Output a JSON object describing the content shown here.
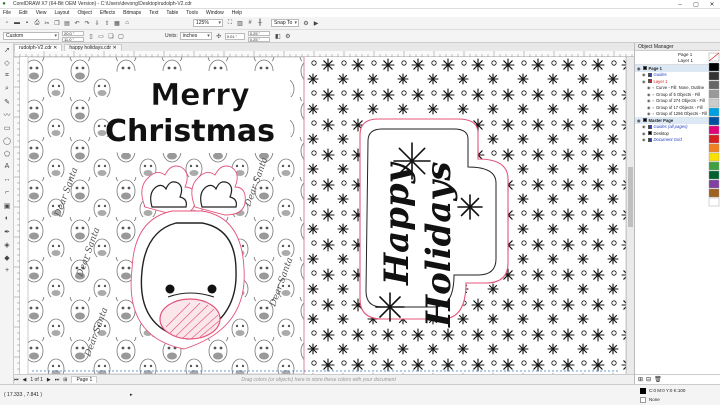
{
  "window": {
    "title": "CorelDRAW X7 (64-Bit OEM Version) - C:\\Users\\devong\\Desktop\\rudolph-V2.cdr",
    "min": "–",
    "max": "▢",
    "close": "✕"
  },
  "menu": [
    "File",
    "Edit",
    "View",
    "Layout",
    "Object",
    "Effects",
    "Bitmaps",
    "Text",
    "Table",
    "Tools",
    "Window",
    "Help"
  ],
  "toolbar1": {
    "zoom": "125%",
    "snap": "Snap To"
  },
  "toolbar2": {
    "preset": "Custom",
    "width": "20.0 \"",
    "height": "11.0 \"",
    "units_label": "Units:",
    "units": "inches",
    "nudge": "0.01 \"",
    "dup_x": "0.25 \"",
    "dup_y": "0.25 \""
  },
  "tabs": [
    "rudolph-V2.cdr",
    "happy holidays.cdr"
  ],
  "pagenav": {
    "counter": "1 of 1",
    "page": "Page 1",
    "hint": "Drag colors (or objects) here to store these colors with your document"
  },
  "card_left": {
    "line1": "Merry",
    "line2": "Christmas",
    "pattern_text": "Dear Santa"
  },
  "card_right": {
    "line1": "Happy",
    "line2": "Holidays"
  },
  "docker": {
    "title": "Object Manager",
    "page_label": "Page 1",
    "layer_label": "Layer 1",
    "rows": [
      {
        "text": "Page 1",
        "level": 0,
        "swatch": "#000000"
      },
      {
        "text": "Guides",
        "level": 1,
        "swatch": "#1f3fbf"
      },
      {
        "text": "Layer 1",
        "level": 1,
        "swatch": "#d62020"
      },
      {
        "text": "Curve - Fill: None, Outline",
        "level": 2,
        "swatch": ""
      },
      {
        "text": "Group of 5 Objects - Fill",
        "level": 2,
        "swatch": ""
      },
      {
        "text": "Group of 274 Objects - Fill",
        "level": 2,
        "swatch": ""
      },
      {
        "text": "Group of 17 Objects - Fill",
        "level": 2,
        "swatch": ""
      },
      {
        "text": "Group of 1266 Objects - Fill",
        "level": 2,
        "swatch": ""
      },
      {
        "text": "Master Page",
        "level": 0,
        "swatch": "#000000"
      },
      {
        "text": "Guides (all pages)",
        "level": 1,
        "swatch": "#1f3fbf"
      },
      {
        "text": "Desktop",
        "level": 1,
        "swatch": "#000000"
      },
      {
        "text": "Document Grid",
        "level": 1,
        "swatch": "#1f3fbf"
      }
    ]
  },
  "status": {
    "coords": "( 17.333 , 7.841 )",
    "fill": "C:0 M:0 Y:0 K:100",
    "outline": "None"
  },
  "colors": {
    "pink": "#e4557a",
    "accent": "#3a78c3"
  }
}
